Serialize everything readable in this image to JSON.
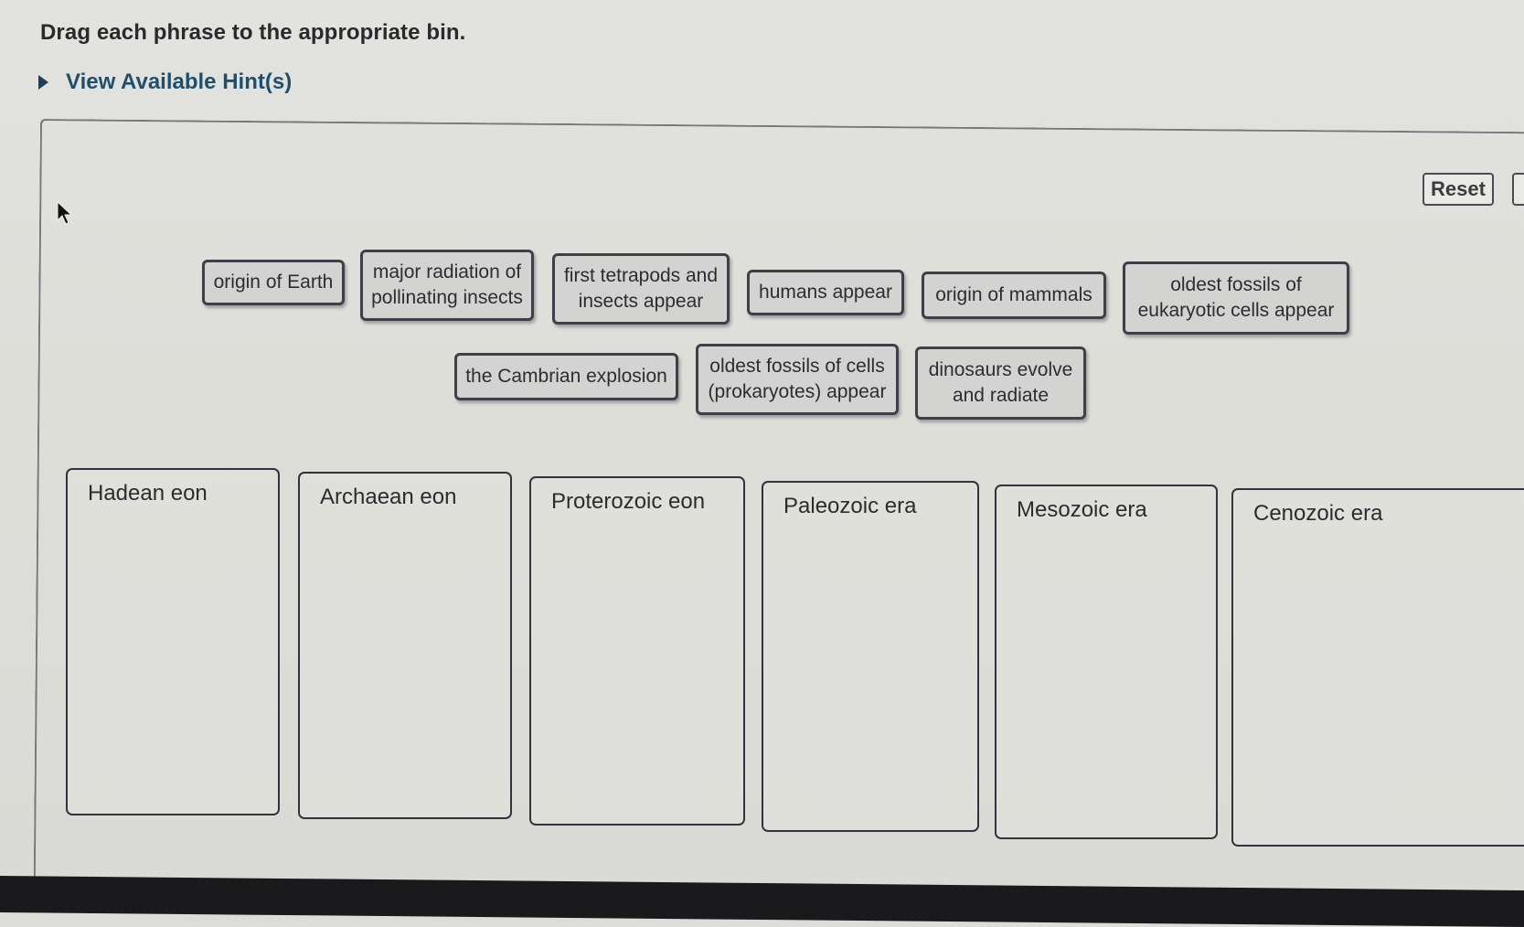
{
  "instruction": "Drag each phrase to the appropriate bin.",
  "hints": {
    "label": "View Available Hint(s)",
    "expanded": false
  },
  "toolbar": {
    "reset_label": "Reset"
  },
  "phrases": [
    "origin of Earth",
    "major radiation of pollinating insects",
    "first tetrapods and insects appear",
    "humans appear",
    "origin of mammals",
    "oldest fossils of eukaryotic cells appear",
    "the Cambrian explosion",
    "oldest fossils of cells (prokaryotes) appear",
    "dinosaurs evolve and radiate"
  ],
  "phrase_lines": [
    [
      "origin of Earth"
    ],
    [
      "major radiation of",
      "pollinating insects"
    ],
    [
      "first tetrapods and",
      "insects appear"
    ],
    [
      "humans appear"
    ],
    [
      "origin of mammals"
    ],
    [
      "oldest fossils of",
      "eukaryotic cells appear"
    ],
    [
      "the Cambrian explosion"
    ],
    [
      "oldest fossils of cells",
      "(prokaryotes) appear"
    ],
    [
      "dinosaurs evolve",
      "and radiate"
    ]
  ],
  "bins": [
    {
      "label": "Hadean eon",
      "items": []
    },
    {
      "label": "Archaean eon",
      "items": []
    },
    {
      "label": "Proterozoic eon",
      "items": []
    },
    {
      "label": "Paleozoic era",
      "items": []
    },
    {
      "label": "Mesozoic era",
      "items": []
    },
    {
      "label": "Cenozoic era",
      "items": []
    }
  ]
}
